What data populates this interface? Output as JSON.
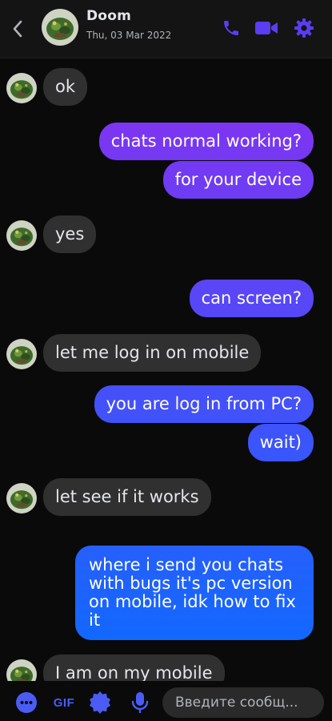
{
  "header": {
    "name": "Doom",
    "subtitle": "Thu, 03 Mar 2022",
    "back_icon": "chevron-left-icon",
    "call_icon": "phone-icon",
    "video_icon": "video-camera-icon",
    "settings_icon": "gear-icon",
    "accent_color": "#5b3df2"
  },
  "messages": [
    {
      "from": "contact",
      "text": "ok"
    },
    {
      "from": "me",
      "text": "chats normal working?"
    },
    {
      "from": "me",
      "text": "for your device"
    },
    {
      "from": "contact",
      "text": "yes"
    },
    {
      "from": "me",
      "text": "can screen?"
    },
    {
      "from": "contact",
      "text": "let me log in on mobile"
    },
    {
      "from": "me",
      "text": "you are log in from PC?"
    },
    {
      "from": "me",
      "text": "wait)"
    },
    {
      "from": "contact",
      "text": "let see if it works"
    },
    {
      "from": "me",
      "text": "where i send you chats with bugs it's pc version on mobile, idk how to fix it"
    },
    {
      "from": "contact",
      "text": "I am on my mobile"
    }
  ],
  "bubble_colors": {
    "incoming": "#303030",
    "outgoing_gradient_top": "#8a2ff0",
    "outgoing_gradient_bottom": "#0a6cff"
  },
  "composer": {
    "gif_label": "GIF",
    "placeholder": "Введите сообщ...",
    "plus_icon": "more-dots-icon",
    "sticker_icon": "sticker-icon",
    "mic_icon": "microphone-icon"
  }
}
